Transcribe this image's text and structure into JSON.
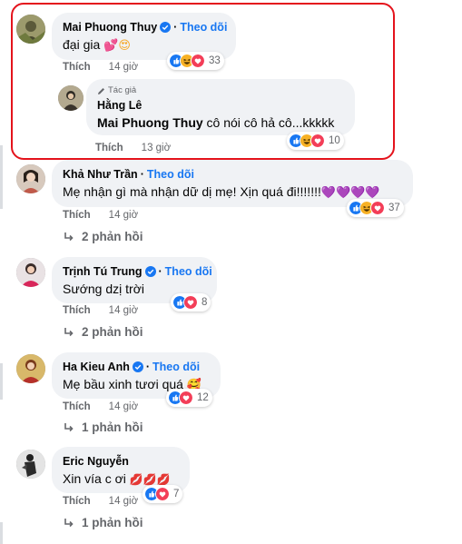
{
  "accent": "#1877f2",
  "highlight_color": "#e4131c",
  "icons": {
    "verified": "verified-badge-icon",
    "reply_arrow": "reply-arrow-icon",
    "like": "like-reaction-icon",
    "haha": "haha-reaction-icon",
    "love": "love-reaction-icon",
    "pencil": "pencil-icon"
  },
  "comments": [
    {
      "name": "Mai Phuong Thuy",
      "follow": "Theo dõi",
      "text": "đại gia",
      "action_like": "Thích",
      "time": "14 giờ",
      "reactions_count": "33"
    },
    {
      "author_tag": "Tác giả",
      "name": "Hằng Lê",
      "mention": "Mai Phuong Thuy",
      "text": " cô nói cô hả cô...kkkkk",
      "action_like": "Thích",
      "time": "13 giờ",
      "reactions_count": "10"
    },
    {
      "name": "Khả Như Trần",
      "follow": "Theo dõi",
      "text": "Mẹ nhận gì mà nhận dữ dị mẹ! Xịn quá đi!!!!!!!",
      "action_like": "Thích",
      "time": "14 giờ",
      "reactions_count": "37",
      "replies": "2 phản hồi"
    },
    {
      "name": "Trịnh Tú Trung",
      "follow": "Theo dõi",
      "text": "Sướng dzị trời",
      "action_like": "Thích",
      "time": "14 giờ",
      "reactions_count": "8",
      "replies": "2 phản hồi"
    },
    {
      "name": "Ha Kieu Anh",
      "follow": "Theo dõi",
      "text": "Mẹ bầu xinh tươi quá",
      "action_like": "Thích",
      "time": "14 giờ",
      "reactions_count": "12",
      "replies": "1 phản hồi"
    },
    {
      "name": "Eric Nguyễn",
      "text": "Xin vía c ơi",
      "action_like": "Thích",
      "time": "14 giờ",
      "reactions_count": "7",
      "replies": "1 phản hồi"
    }
  ]
}
